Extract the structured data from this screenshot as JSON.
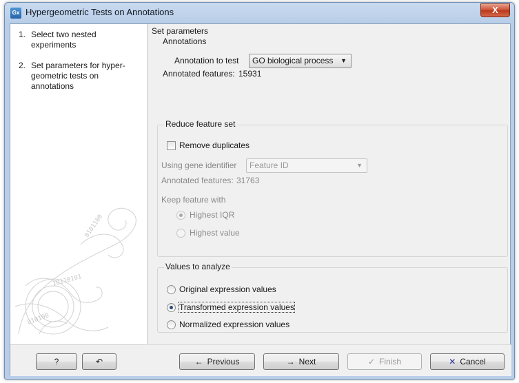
{
  "window": {
    "title": "Hypergeometric Tests on Annotations",
    "app_icon_label": "Gx",
    "close_glyph": "X"
  },
  "steps": [
    {
      "number": "1.",
      "label": "Select two nested experiments"
    },
    {
      "number": "2.",
      "label": "Set parameters for hyper-geometric tests on annotations"
    }
  ],
  "main": {
    "header": "Set parameters",
    "annotations": {
      "title": "Annotations",
      "annotation_label": "Annotation to test",
      "annotation_value": "GO biological process",
      "annotated_features_label": "Annotated features:",
      "annotated_features_value": "15931"
    },
    "reduce": {
      "title": "Reduce feature set",
      "remove_duplicates_label": "Remove duplicates",
      "remove_duplicates_checked": false,
      "gene_identifier_label": "Using gene identifier",
      "gene_identifier_value": "Feature ID",
      "annotated_features_label": "Annotated features:",
      "annotated_features_value": "31763",
      "keep_label": "Keep feature with",
      "keep_options": [
        "Highest IQR",
        "Highest value"
      ],
      "keep_selected": "Highest IQR"
    },
    "values": {
      "title": "Values to analyze",
      "options": [
        "Original expression values",
        "Transformed expression values",
        "Normalized expression values"
      ],
      "selected": "Transformed expression values"
    }
  },
  "buttons": {
    "help": "?",
    "reset_icon": "reset-icon",
    "previous": "Previous",
    "next": "Next",
    "finish": "Finish",
    "cancel": "Cancel"
  },
  "colors": {
    "accent_title": "#b8cde8",
    "close_red": "#c94c2e",
    "cancel_x": "#1f2f8f"
  }
}
